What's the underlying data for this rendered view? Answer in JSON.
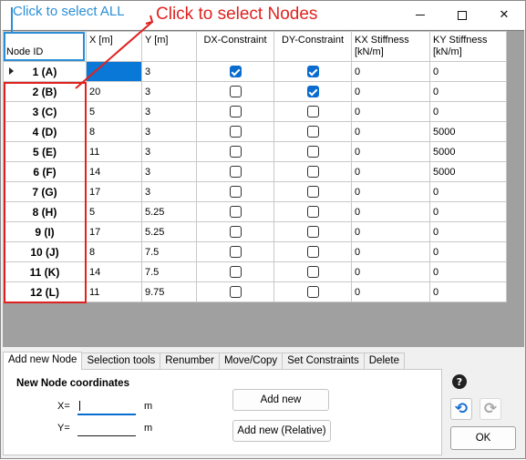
{
  "window": {
    "controls": {
      "minimize": "minimize-icon",
      "maximize": "maximize-icon",
      "close": "✕"
    }
  },
  "annotations": {
    "select_all": "Click to select ALL",
    "select_nodes": "Click to select Nodes",
    "colors": {
      "red": "#e0221f",
      "blue": "#2a8fd6"
    }
  },
  "grid": {
    "columns": [
      "Node ID",
      "X [m]",
      "Y [m]",
      "DX-Constraint",
      "DY-Constraint",
      "KX Stiffness [kN/m]",
      "KY Stiffness [kN/m]"
    ],
    "rows": [
      {
        "id": "1 (A)",
        "x": "",
        "y": "3",
        "dx": true,
        "dy": true,
        "kx": "0",
        "ky": "0"
      },
      {
        "id": "2 (B)",
        "x": "20",
        "y": "3",
        "dx": false,
        "dy": true,
        "kx": "0",
        "ky": "0"
      },
      {
        "id": "3 (C)",
        "x": "5",
        "y": "3",
        "dx": false,
        "dy": false,
        "kx": "0",
        "ky": "0"
      },
      {
        "id": "4 (D)",
        "x": "8",
        "y": "3",
        "dx": false,
        "dy": false,
        "kx": "0",
        "ky": "5000"
      },
      {
        "id": "5 (E)",
        "x": "11",
        "y": "3",
        "dx": false,
        "dy": false,
        "kx": "0",
        "ky": "5000"
      },
      {
        "id": "6 (F)",
        "x": "14",
        "y": "3",
        "dx": false,
        "dy": false,
        "kx": "0",
        "ky": "5000"
      },
      {
        "id": "7 (G)",
        "x": "17",
        "y": "3",
        "dx": false,
        "dy": false,
        "kx": "0",
        "ky": "0"
      },
      {
        "id": "8 (H)",
        "x": "5",
        "y": "5.25",
        "dx": false,
        "dy": false,
        "kx": "0",
        "ky": "0"
      },
      {
        "id": "9 (I)",
        "x": "17",
        "y": "5.25",
        "dx": false,
        "dy": false,
        "kx": "0",
        "ky": "0"
      },
      {
        "id": "10 (J)",
        "x": "8",
        "y": "7.5",
        "dx": false,
        "dy": false,
        "kx": "0",
        "ky": "0"
      },
      {
        "id": "11 (K)",
        "x": "14",
        "y": "7.5",
        "dx": false,
        "dy": false,
        "kx": "0",
        "ky": "0"
      },
      {
        "id": "12 (L)",
        "x": "11",
        "y": "9.75",
        "dx": false,
        "dy": false,
        "kx": "0",
        "ky": "0"
      }
    ]
  },
  "tabs": [
    "Add new Node",
    "Selection tools",
    "Renumber",
    "Move/Copy",
    "Set Constraints",
    "Delete"
  ],
  "add_node": {
    "title": "New Node coordinates",
    "x_label": "X=",
    "y_label": "Y=",
    "x_value": "",
    "y_value": "",
    "unit": "m",
    "add_button": "Add new",
    "add_relative_button": "Add new (Relative)"
  },
  "side": {
    "help": "?",
    "undo": "undo-icon",
    "redo": "redo-icon",
    "ok": "OK"
  }
}
